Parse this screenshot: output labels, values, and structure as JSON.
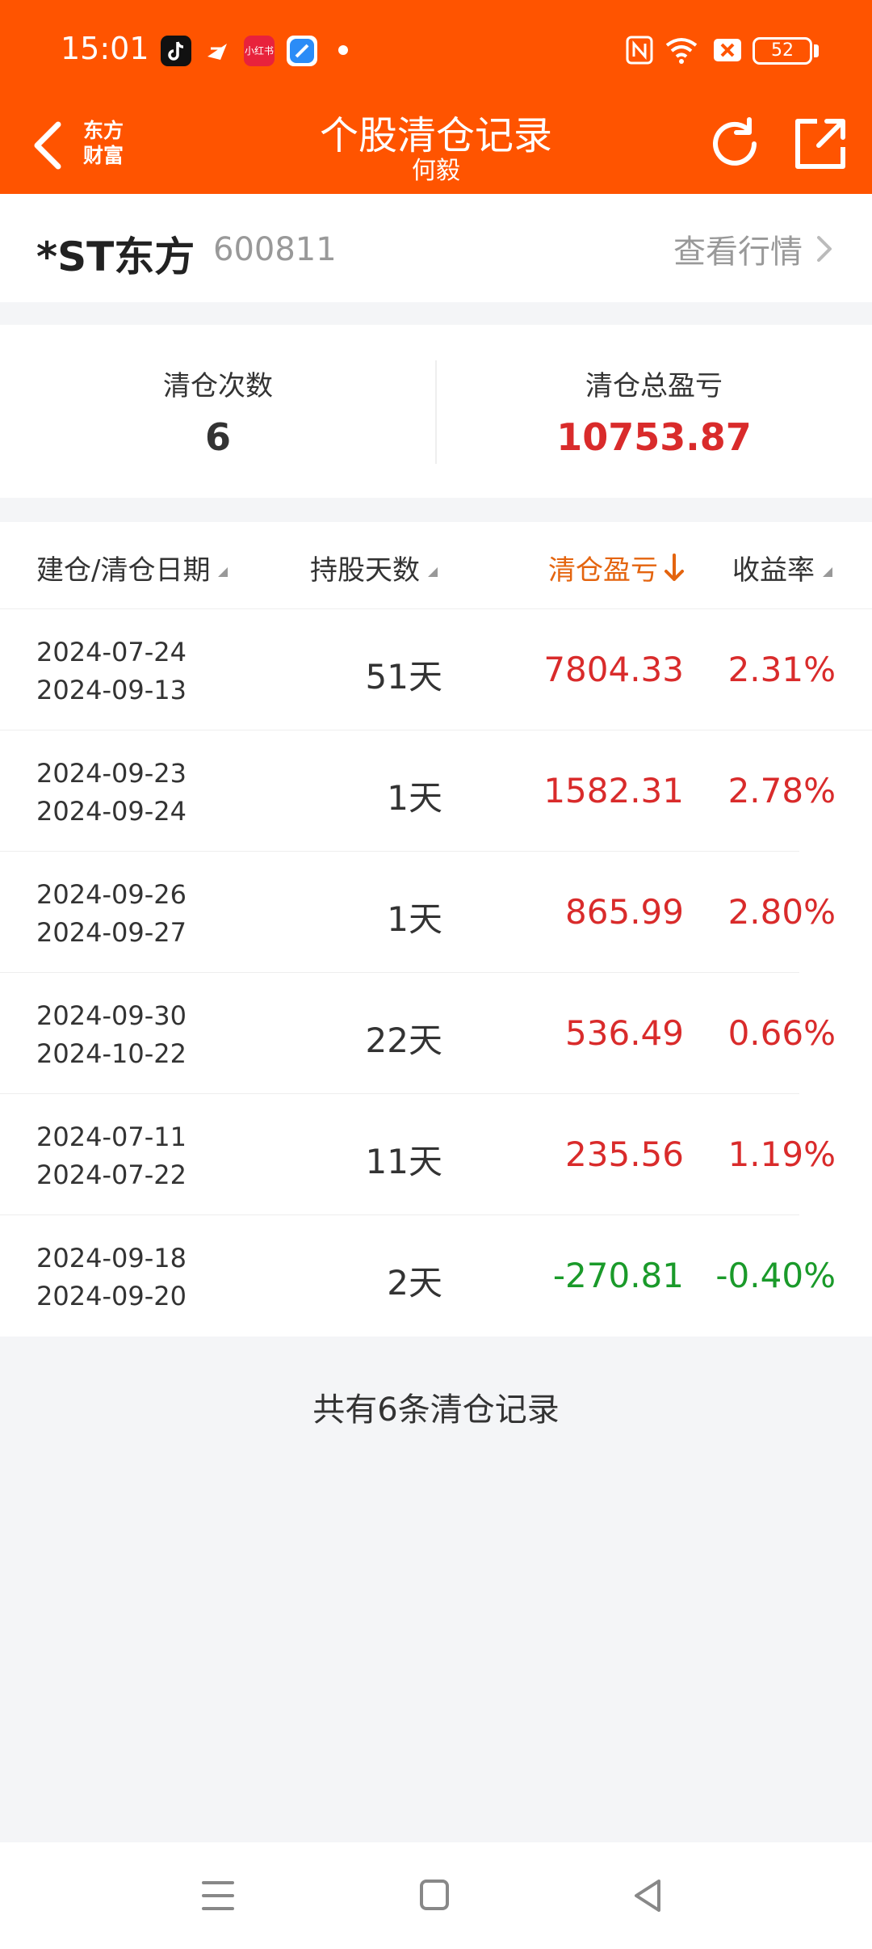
{
  "status_bar": {
    "time": "15:01",
    "battery": "52",
    "app_icons": [
      "douyin-icon",
      "feishu-icon",
      "xiaohongshu-icon",
      "browser-icon"
    ],
    "xiaohongshu_label": "小红书"
  },
  "header": {
    "logo_line1": "东方",
    "logo_line2": "财富",
    "title": "个股清仓记录",
    "subtitle": "何毅",
    "bg_color": "#ff5400"
  },
  "stock": {
    "name": "*ST东方",
    "code": "600811",
    "market_link": "查看行情"
  },
  "summary": {
    "count_label": "清仓次数",
    "count_value": "6",
    "total_label": "清仓总盈亏",
    "total_value": "10753.87"
  },
  "table": {
    "headers": {
      "dates": "建仓/清仓日期",
      "days": "持股天数",
      "pnl": "清仓盈亏",
      "rate": "收益率"
    },
    "rows": [
      {
        "open": "2024-07-24",
        "close": "2024-09-13",
        "days": "51天",
        "pnl": "7804.33",
        "rate": "2.31%",
        "sign": "up"
      },
      {
        "open": "2024-09-23",
        "close": "2024-09-24",
        "days": "1天",
        "pnl": "1582.31",
        "rate": "2.78%",
        "sign": "up"
      },
      {
        "open": "2024-09-26",
        "close": "2024-09-27",
        "days": "1天",
        "pnl": "865.99",
        "rate": "2.80%",
        "sign": "up"
      },
      {
        "open": "2024-09-30",
        "close": "2024-10-22",
        "days": "22天",
        "pnl": "536.49",
        "rate": "0.66%",
        "sign": "up"
      },
      {
        "open": "2024-07-11",
        "close": "2024-07-22",
        "days": "11天",
        "pnl": "235.56",
        "rate": "1.19%",
        "sign": "up"
      },
      {
        "open": "2024-09-18",
        "close": "2024-09-20",
        "days": "2天",
        "pnl": "-270.81",
        "rate": "-0.40%",
        "sign": "down"
      }
    ]
  },
  "footer_note": "共有6条清仓记录",
  "colors": {
    "up": "#d92b2b",
    "down": "#1a9a2a",
    "active_sort": "#e4640e"
  }
}
